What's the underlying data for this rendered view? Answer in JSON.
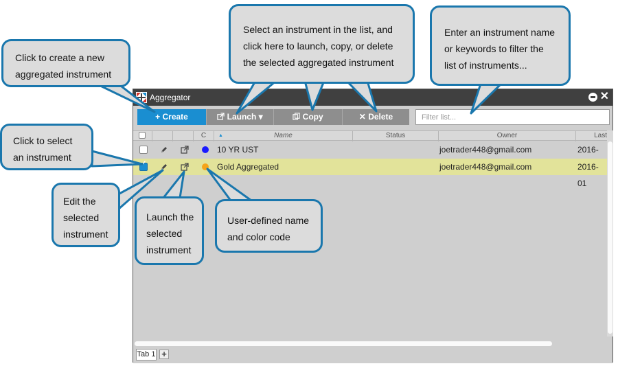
{
  "window": {
    "title": "Aggregator",
    "toolbar": {
      "create_label": "+ Create",
      "launch_label": "Launch",
      "copy_label": "Copy",
      "delete_label": "Delete",
      "filter_placeholder": "Filter list..."
    },
    "columns": {
      "c": "C",
      "sort_indicator": "▲",
      "name": "Name",
      "status": "Status",
      "owner": "Owner",
      "last": "Last"
    },
    "rows": [
      {
        "checked": false,
        "color": "#1a1aff",
        "name": "10 YR UST",
        "status": "",
        "owner": "joetrader448@gmail.com",
        "last": "2016-01"
      },
      {
        "checked": true,
        "color": "#f5a41a",
        "name": "Gold Aggregated",
        "status": "",
        "owner": "joetrader448@gmail.com",
        "last": "2016-01"
      }
    ],
    "tabs": {
      "tab_1": "Tab 1",
      "add": "+"
    },
    "colors": {
      "accent": "#1a8ed1",
      "selected_row": "#e2e39a",
      "callout_border": "#1a77ad"
    },
    "icons": [
      "app-logo-icon",
      "minimize-icon",
      "close-icon",
      "edit-icon",
      "launch-icon",
      "copy-icon",
      "delete-icon"
    ]
  },
  "callouts": {
    "create": [
      "Click to create a new",
      "aggregated instrument"
    ],
    "launch_copy_delete": [
      "Select an instrument in the list, and",
      "click here to launch, copy, or delete",
      "the selected aggregated instrument"
    ],
    "filter": [
      "Enter an instrument name",
      "or keywords to filter the",
      "list of instruments..."
    ],
    "select": [
      "Click to select",
      "an instrument"
    ],
    "edit": [
      "Edit the",
      "selected",
      "instrument"
    ],
    "launch": [
      "Launch the",
      "selected",
      "instrument"
    ],
    "name_color": [
      "User-defined name",
      "and color code"
    ]
  }
}
